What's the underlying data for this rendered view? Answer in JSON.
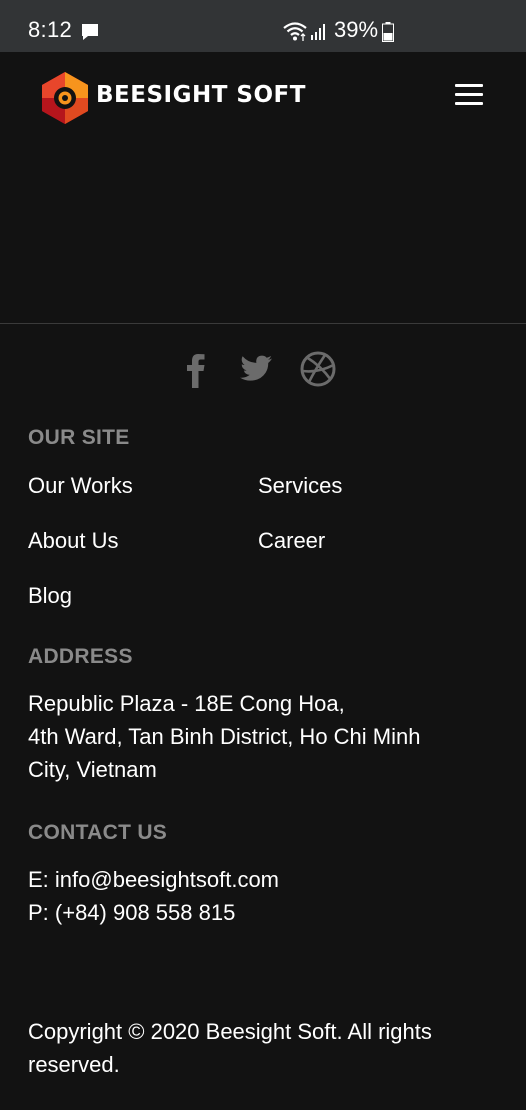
{
  "status_bar": {
    "time": "8:12",
    "battery": "39%"
  },
  "header": {
    "brand": "BEESIGHT SOFT",
    "logo_colors": [
      "#f7941d",
      "#e8462b",
      "#c3191f"
    ]
  },
  "social": {
    "icons": [
      "facebook-icon",
      "twitter-icon",
      "dribbble-icon"
    ],
    "icon_color": "#6b6b6b"
  },
  "our_site": {
    "heading": "OUR SITE",
    "links": {
      "our_works": "Our Works",
      "services": "Services",
      "about_us": "About Us",
      "career": "Career",
      "blog": "Blog"
    }
  },
  "address": {
    "heading": "ADDRESS",
    "lines": [
      "Republic Plaza - 18E Cong Hoa,",
      "4th Ward, Tan Binh District, Ho Chi Minh",
      "City, Vietnam"
    ]
  },
  "contact": {
    "heading": "CONTACT US",
    "email": "E: info@beesightsoft.com",
    "phone": "P: (+84) 908 558 815"
  },
  "footer": {
    "copyright_lines": [
      "Copyright © 2020 Beesight Soft. All rights",
      "reserved."
    ]
  }
}
